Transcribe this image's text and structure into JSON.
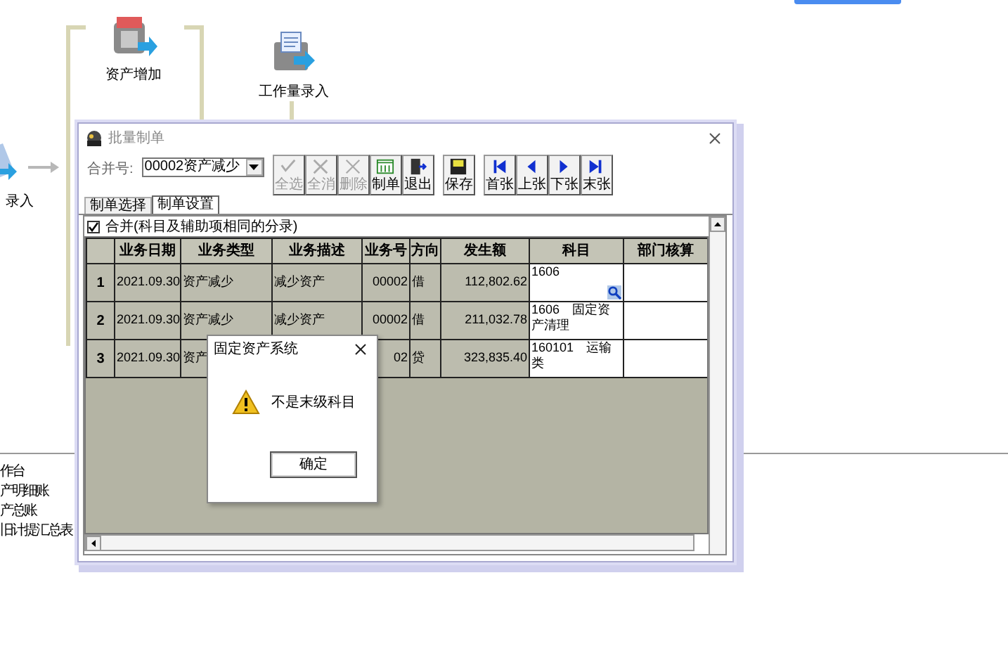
{
  "flow_nodes": [
    {
      "label": "资产增加",
      "kind": "asset"
    },
    {
      "label": "工作量录入",
      "kind": "workload"
    },
    {
      "label": "录入",
      "kind": "entry"
    }
  ],
  "side_menu": [
    "作台",
    "产明细账",
    "产总账",
    "旧计提汇总表"
  ],
  "window": {
    "title": "批量制单",
    "merge_label": "合并号:",
    "merge_value": "00002资产减少",
    "toolbar_groups": [
      [
        {
          "label": "全选",
          "kind": "select_all",
          "disabled": true
        },
        {
          "label": "全消",
          "kind": "clear_all",
          "disabled": true
        },
        {
          "label": "删除",
          "kind": "delete",
          "disabled": true
        },
        {
          "label": "制单",
          "kind": "make",
          "disabled": false
        },
        {
          "label": "退出",
          "kind": "exit",
          "disabled": false
        }
      ],
      [
        {
          "label": "保存",
          "kind": "save",
          "disabled": false
        }
      ],
      [
        {
          "label": "首张",
          "kind": "first",
          "disabled": false
        },
        {
          "label": "上张",
          "kind": "prev",
          "disabled": false
        },
        {
          "label": "下张",
          "kind": "next",
          "disabled": false
        },
        {
          "label": "末张",
          "kind": "last",
          "disabled": false
        }
      ]
    ],
    "tabs": [
      {
        "label": "制单选择",
        "selected": false
      },
      {
        "label": "制单设置",
        "selected": true
      }
    ],
    "merge_option": {
      "label": "合并(科目及辅助项相同的分录)",
      "checked": true
    },
    "table": {
      "columns": [
        {
          "editable": false
        },
        {
          "label": "业务日期",
          "editable": false
        },
        {
          "label": "业务类型",
          "editable": false
        },
        {
          "label": "业务描述",
          "editable": false
        },
        {
          "label": "业务号",
          "editable": false
        },
        {
          "label": "方向",
          "editable": false
        },
        {
          "label": "发生额",
          "editable": false
        },
        {
          "label": "科目",
          "editable": true
        },
        {
          "label": "部门核算",
          "editable": true
        }
      ],
      "rows": [
        {
          "cells": [
            "1",
            "2021.09.30",
            "资产减少",
            "减少资产",
            "00002",
            "借",
            "112,802.62",
            "1606",
            null
          ],
          "editing": true
        },
        {
          "cells": [
            "2",
            "2021.09.30",
            "资产减少",
            "减少资产",
            "00002",
            "借",
            "211,032.78",
            "1606　固定资产清理",
            null
          ],
          "editing": false
        },
        {
          "cells": [
            "3",
            "2021.09.30",
            "资产",
            null,
            "02",
            "贷",
            "323,835.40",
            "160101　运输类",
            null
          ],
          "editing": false
        }
      ]
    }
  },
  "message_box": {
    "title": "固定资产系统",
    "message": "不是末级科目",
    "button": "确定"
  }
}
